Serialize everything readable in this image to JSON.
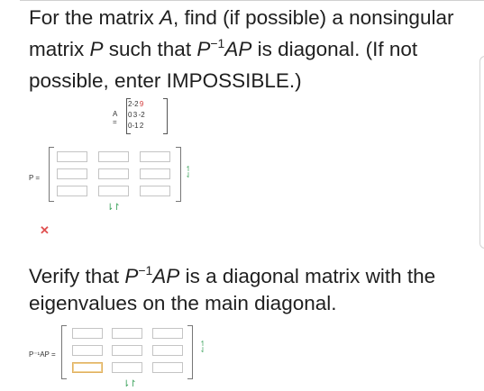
{
  "prompt": {
    "part1": "For the matrix ",
    "var_A": "A",
    "part2": ", find (if possible) a nonsingular matrix ",
    "var_P": "P",
    "part3": " such that ",
    "P": "P",
    "inv_exp": "−1",
    "AP": "AP",
    "part4": " is diagonal. (If not possible, enter IMPOSSIBLE.)"
  },
  "matrix_A": {
    "label": "A =",
    "rows": [
      [
        "2",
        "-2",
        "9"
      ],
      [
        "0",
        "3",
        "-2"
      ],
      [
        "0",
        "-1",
        "2"
      ]
    ]
  },
  "matrix_P": {
    "label": "P =",
    "cells": [
      [
        "",
        "",
        ""
      ],
      [
        "",
        "",
        ""
      ],
      [
        "",
        "",
        ""
      ]
    ]
  },
  "status": {
    "wrong_icon": "✕"
  },
  "verify": {
    "part1": "Verify that ",
    "P": "P",
    "inv_exp": "−1",
    "AP": "AP",
    "part2": " is a diagonal matrix with the eigenvalues on the main diagonal."
  },
  "matrix_PAP": {
    "label": "P⁻¹AP =",
    "cells": [
      [
        "",
        "",
        ""
      ],
      [
        "",
        "",
        ""
      ],
      [
        "",
        "",
        ""
      ]
    ]
  },
  "controls": {
    "col_arrows_glyph": "⇂↾",
    "row_add_glyph": "↿",
    "row_remove_glyph": "⇃"
  },
  "colors": {
    "arrow": "#3aa25a",
    "error": "#e05050",
    "highlight": "#d23a3a",
    "active_border": "#e0b060"
  }
}
